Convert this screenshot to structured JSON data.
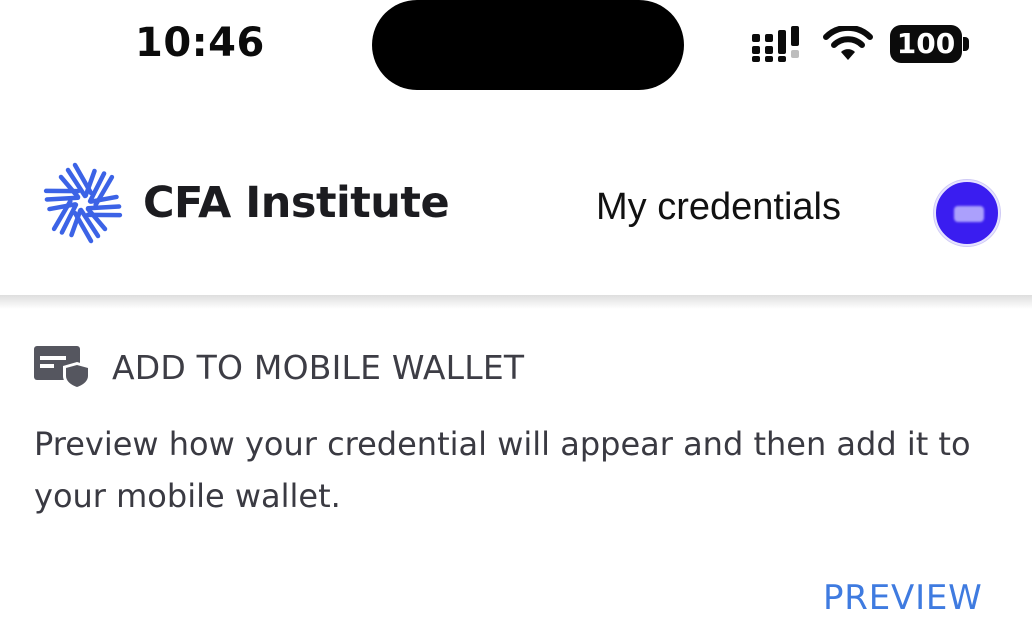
{
  "status_bar": {
    "time": "10:46",
    "battery": "100",
    "signal_icon": "cellular-signal-icon",
    "wifi_icon": "wifi-icon"
  },
  "header": {
    "logo_icon": "cfa-institute-logo-icon",
    "logo_text": "CFA Institute",
    "nav_label": "My credentials",
    "avatar_color": "#3a1df0"
  },
  "wallet": {
    "icon": "wallet-card-shield-icon",
    "title": "ADD TO MOBILE WALLET",
    "description": "Preview how your credential will appear and then add it to your mobile wallet.",
    "preview_label": "PREVIEW",
    "accent_color": "#3f7be0"
  }
}
